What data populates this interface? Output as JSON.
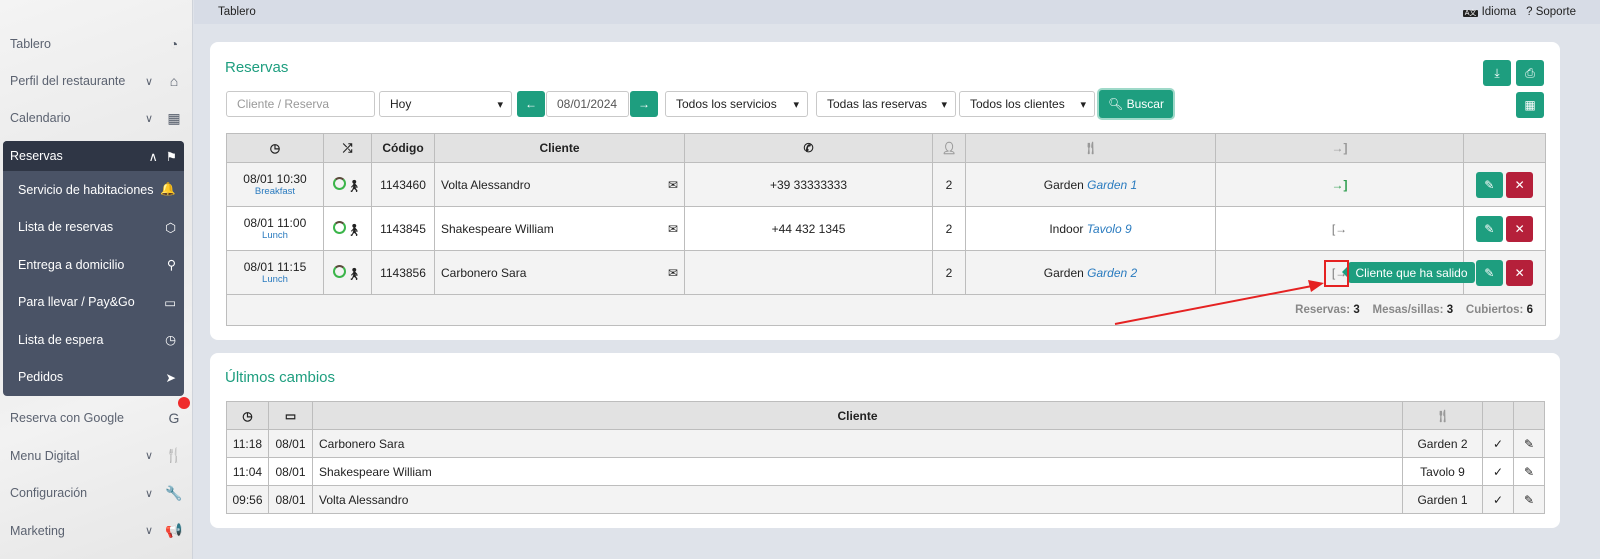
{
  "sidebar": {
    "items": [
      {
        "label": "Tablero",
        "icon": "dashboard-icon",
        "glyph": "◔",
        "chev": false
      },
      {
        "label": "Perfil del restaurante",
        "icon": "home-icon",
        "glyph": "⌂",
        "chev": true
      },
      {
        "label": "Calendario",
        "icon": "calendar-icon",
        "glyph": "▦",
        "chev": true
      }
    ],
    "active": {
      "label": "Reservas",
      "icon": "flag-checkered-icon",
      "glyph": "⚑",
      "children": [
        {
          "label": "Servicio de habitaciones",
          "icon": "bell-icon",
          "glyph": "🔔"
        },
        {
          "label": "Lista de reservas",
          "icon": "cube-icon",
          "glyph": "⬡"
        },
        {
          "label": "Entrega a domicilio",
          "icon": "bicycle-icon",
          "glyph": "⚲"
        },
        {
          "label": "Para llevar / Pay&Go",
          "icon": "car-icon",
          "glyph": "▭"
        },
        {
          "label": "Lista de espera",
          "icon": "clock-icon",
          "glyph": "◷"
        },
        {
          "label": "Pedidos",
          "icon": "paper-plane-icon",
          "glyph": "➤"
        }
      ]
    },
    "bottom": [
      {
        "label": "Reserva con Google",
        "icon": "google-icon",
        "glyph": "G",
        "chev": false
      },
      {
        "label": "Menu Digital",
        "icon": "utensils-icon",
        "glyph": "🍴",
        "chev": true
      },
      {
        "label": "Configuración",
        "icon": "wrench-icon",
        "glyph": "🔧",
        "chev": true
      },
      {
        "label": "Marketing",
        "icon": "bullhorn-icon",
        "glyph": "📢",
        "chev": true
      }
    ]
  },
  "topbar": {
    "breadcrumb": "Tablero",
    "language": "Idioma",
    "support": "Soporte"
  },
  "reservas": {
    "title": "Reservas",
    "filters": {
      "search_placeholder": "Cliente  / Reserva",
      "period": "Hoy",
      "date": "08/01/2024",
      "services": "Todos los servicios",
      "reservations": "Todas las reservas",
      "clients": "Todos los clientes",
      "search_button": "Buscar"
    },
    "columns": {
      "code": "Código",
      "client": "Cliente"
    },
    "rows": [
      {
        "datetime": "08/01 10:30",
        "service": "Breakfast",
        "code": "1143460",
        "client": "Volta Alessandro",
        "phone": "+39 33333333",
        "guests": "2",
        "area": "Garden",
        "table": "Garden 1",
        "status": "checked-in"
      },
      {
        "datetime": "08/01 11:00",
        "service": "Lunch",
        "code": "1143845",
        "client": "Shakespeare William",
        "phone": "+44 432 1345",
        "guests": "2",
        "area": "Indoor",
        "table": "Tavolo 9",
        "status": "checked-out"
      },
      {
        "datetime": "08/01 11:15",
        "service": "Lunch",
        "code": "1143856",
        "client": "Carbonero Sara",
        "phone": "",
        "guests": "2",
        "area": "Garden",
        "table": "Garden 2",
        "status": "checked-out"
      }
    ],
    "summary": {
      "reservas_label": "Reservas:",
      "reservas": "3",
      "mesas_label": "Mesas/sillas:",
      "mesas": "3",
      "cubiertos_label": "Cubiertos:",
      "cubiertos": "6"
    },
    "tooltip": "Cliente que ha salido"
  },
  "cambios": {
    "title": "Últimos cambios",
    "client_col": "Cliente",
    "rows": [
      {
        "time": "11:18",
        "date": "08/01",
        "client": "Carbonero Sara",
        "table": "Garden 2"
      },
      {
        "time": "11:04",
        "date": "08/01",
        "client": "Shakespeare William",
        "table": "Tavolo 9"
      },
      {
        "time": "09:56",
        "date": "08/01",
        "client": "Volta Alessandro",
        "table": "Garden 1"
      }
    ]
  },
  "colors": {
    "accent": "#1e9e7f",
    "danger": "#b5203a",
    "sidebar_active": "#4a5366",
    "annotation": "#e52222"
  }
}
